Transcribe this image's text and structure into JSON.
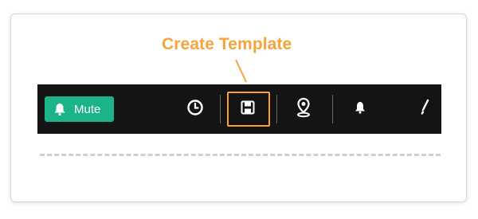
{
  "callout": {
    "label": "Create Template",
    "color": "#f6a43a"
  },
  "toolbar": {
    "background": "#141414",
    "mute_button": {
      "label": "Mute",
      "icon": "bell-icon",
      "color": "#1db38a"
    },
    "tools": [
      {
        "name": "clock-icon"
      },
      {
        "name": "save-template-icon",
        "highlighted": true
      },
      {
        "name": "location-pin-icon"
      },
      {
        "name": "bell-icon"
      },
      {
        "name": "brush-icon"
      }
    ]
  }
}
